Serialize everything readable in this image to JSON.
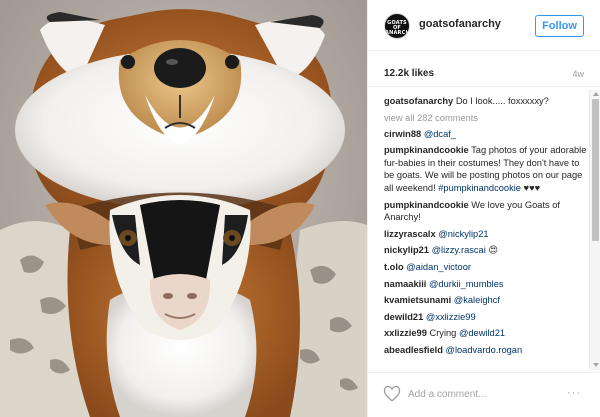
{
  "post": {
    "avatar_text": "GOATS OF ANARCHY",
    "username": "goatsofanarchy",
    "follow_label": "Follow",
    "likes": "12.2k likes",
    "time_ago": "4w"
  },
  "caption": {
    "user": "goatsofanarchy",
    "text": " Do I look..... foxxxxxy?"
  },
  "view_all": "view all 282 comments",
  "comments": [
    {
      "user": "cirwin88",
      "text": " ",
      "mention": "@dcaf_",
      "tail": ""
    },
    {
      "user": "pumpkinandcookie",
      "text": " Tag photos of your adorable fur-babies in their costumes! They don't have to be goats. We will be posting photos on our page all weekend! ",
      "hashtag": "#pumpkinandcookie",
      "tail": " ♥♥♥"
    },
    {
      "user": "pumpkinandcookie",
      "text": " We love you Goats of Anarchy!",
      "mention": "",
      "tail": ""
    },
    {
      "user": "lizzyrascalx",
      "text": " ",
      "mention": "@nickylip21",
      "tail": ""
    },
    {
      "user": "nickylip21",
      "text": " ",
      "mention": "@lizzy.rascai",
      "tail": " 😍"
    },
    {
      "user": "t.olo",
      "text": " ",
      "mention": "@aidan_victoor",
      "tail": ""
    },
    {
      "user": "namaakiii",
      "text": " ",
      "mention": "@durkii_mumbles",
      "tail": ""
    },
    {
      "user": "kvamietsunami",
      "text": " ",
      "mention": "@kaleighcf",
      "tail": ""
    },
    {
      "user": "dewild21",
      "text": " ",
      "mention": "@xxlizzie99",
      "tail": ""
    },
    {
      "user": "xxlizzie99",
      "text": " Crying ",
      "mention": "@dewild21",
      "tail": ""
    },
    {
      "user": "abeadlesfield",
      "text": " ",
      "mention": "@loadvardo.rogan",
      "tail": ""
    }
  ],
  "footer": {
    "heart_icon": "heart-outline-icon",
    "add_comment_placeholder": "Add a comment...",
    "more_label": "···"
  },
  "colors": {
    "accent": "#3897f0",
    "link": "#003569",
    "muted": "#999999",
    "text": "#262626"
  }
}
